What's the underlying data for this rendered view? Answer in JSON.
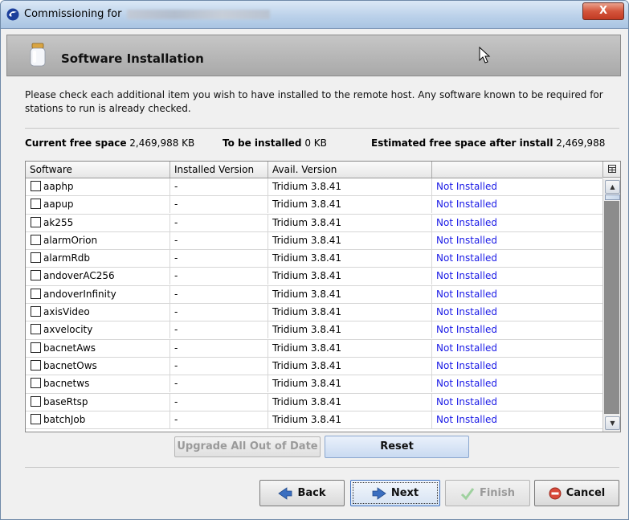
{
  "window": {
    "title": "Commissioning for",
    "close_label": "X"
  },
  "header": {
    "title": "Software Installation"
  },
  "instructions": "Please check each additional item you wish to have installed to the remote host. Any software known to be required for stations to run is already checked.",
  "space": {
    "current_label": "Current free space",
    "current_value": "2,469,988 KB",
    "to_install_label": "To be installed",
    "to_install_value": "0 KB",
    "estimated_label": "Estimated free space after install",
    "estimated_value": "2,469,988"
  },
  "table": {
    "columns": [
      "Software",
      "Installed Version",
      "Avail. Version",
      ""
    ],
    "rows": [
      {
        "name": "aaphp",
        "installed": "-",
        "available": "Tridium 3.8.41",
        "status": "Not Installed"
      },
      {
        "name": "aapup",
        "installed": "-",
        "available": "Tridium 3.8.41",
        "status": "Not Installed"
      },
      {
        "name": "ak255",
        "installed": "-",
        "available": "Tridium 3.8.41",
        "status": "Not Installed"
      },
      {
        "name": "alarmOrion",
        "installed": "-",
        "available": "Tridium 3.8.41",
        "status": "Not Installed"
      },
      {
        "name": "alarmRdb",
        "installed": "-",
        "available": "Tridium 3.8.41",
        "status": "Not Installed"
      },
      {
        "name": "andoverAC256",
        "installed": "-",
        "available": "Tridium 3.8.41",
        "status": "Not Installed"
      },
      {
        "name": "andoverInfinity",
        "installed": "-",
        "available": "Tridium 3.8.41",
        "status": "Not Installed"
      },
      {
        "name": "axisVideo",
        "installed": "-",
        "available": "Tridium 3.8.41",
        "status": "Not Installed"
      },
      {
        "name": "axvelocity",
        "installed": "-",
        "available": "Tridium 3.8.41",
        "status": "Not Installed"
      },
      {
        "name": "bacnetAws",
        "installed": "-",
        "available": "Tridium 3.8.41",
        "status": "Not Installed"
      },
      {
        "name": "bacnetOws",
        "installed": "-",
        "available": "Tridium 3.8.41",
        "status": "Not Installed"
      },
      {
        "name": "bacnetws",
        "installed": "-",
        "available": "Tridium 3.8.41",
        "status": "Not Installed"
      },
      {
        "name": "baseRtsp",
        "installed": "-",
        "available": "Tridium 3.8.41",
        "status": "Not Installed"
      },
      {
        "name": "batchJob",
        "installed": "-",
        "available": "Tridium 3.8.41",
        "status": "Not Installed"
      }
    ]
  },
  "actions": {
    "upgrade_all": "Upgrade All Out of Date",
    "reset": "Reset"
  },
  "wizard": {
    "back": "Back",
    "next": "Next",
    "finish": "Finish",
    "cancel": "Cancel"
  },
  "colors": {
    "status_text": "#1a1ae6",
    "header_bg": "#b4b4b4",
    "title_bar": "#bcd2ea",
    "scroll_track": "#7a7a7a"
  },
  "icons": {
    "app": "tridium-logo-icon",
    "header": "jar-icon",
    "back": "arrow-left-icon",
    "next": "arrow-right-icon",
    "finish": "checkmark-icon",
    "cancel": "cancel-circle-icon"
  }
}
